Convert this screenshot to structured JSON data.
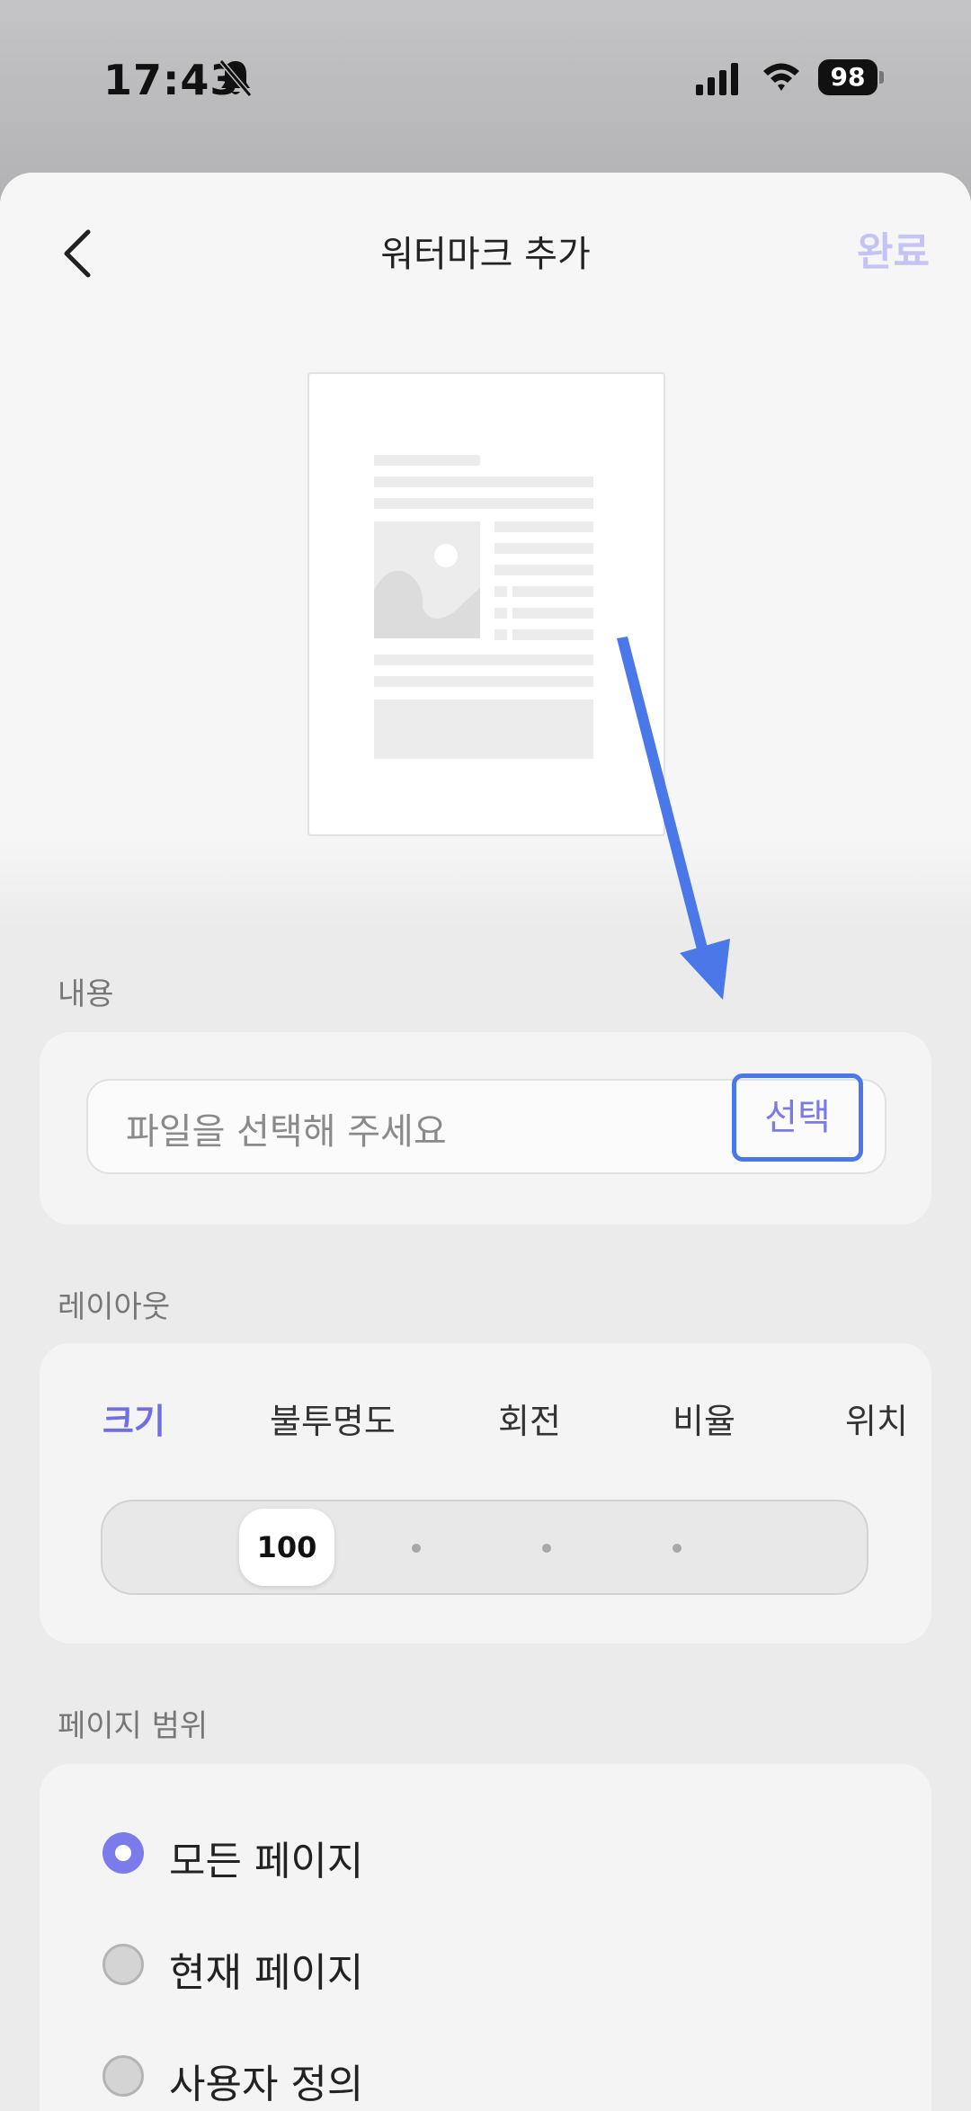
{
  "status_bar": {
    "time": "17:43",
    "battery": "98"
  },
  "nav": {
    "title": "워터마크 추가",
    "done_label": "완료"
  },
  "content_section": {
    "label": "내용",
    "file_placeholder": "파일을 선택해 주세요",
    "select_label": "선택"
  },
  "layout_section": {
    "label": "레이아웃",
    "tabs": [
      "크기",
      "불투명도",
      "회전",
      "비율",
      "위치"
    ],
    "active_tab": "크기",
    "slider_value": "100"
  },
  "page_range_section": {
    "label": "페이지 범위",
    "options": [
      "모든 페이지",
      "현재 페이지",
      "사용자 정의"
    ],
    "selected": "모든 페이지"
  },
  "colors": {
    "accent": "#7b7bec",
    "annotation_arrow": "#4a78e8",
    "done_disabled": "#c4c4f2"
  }
}
